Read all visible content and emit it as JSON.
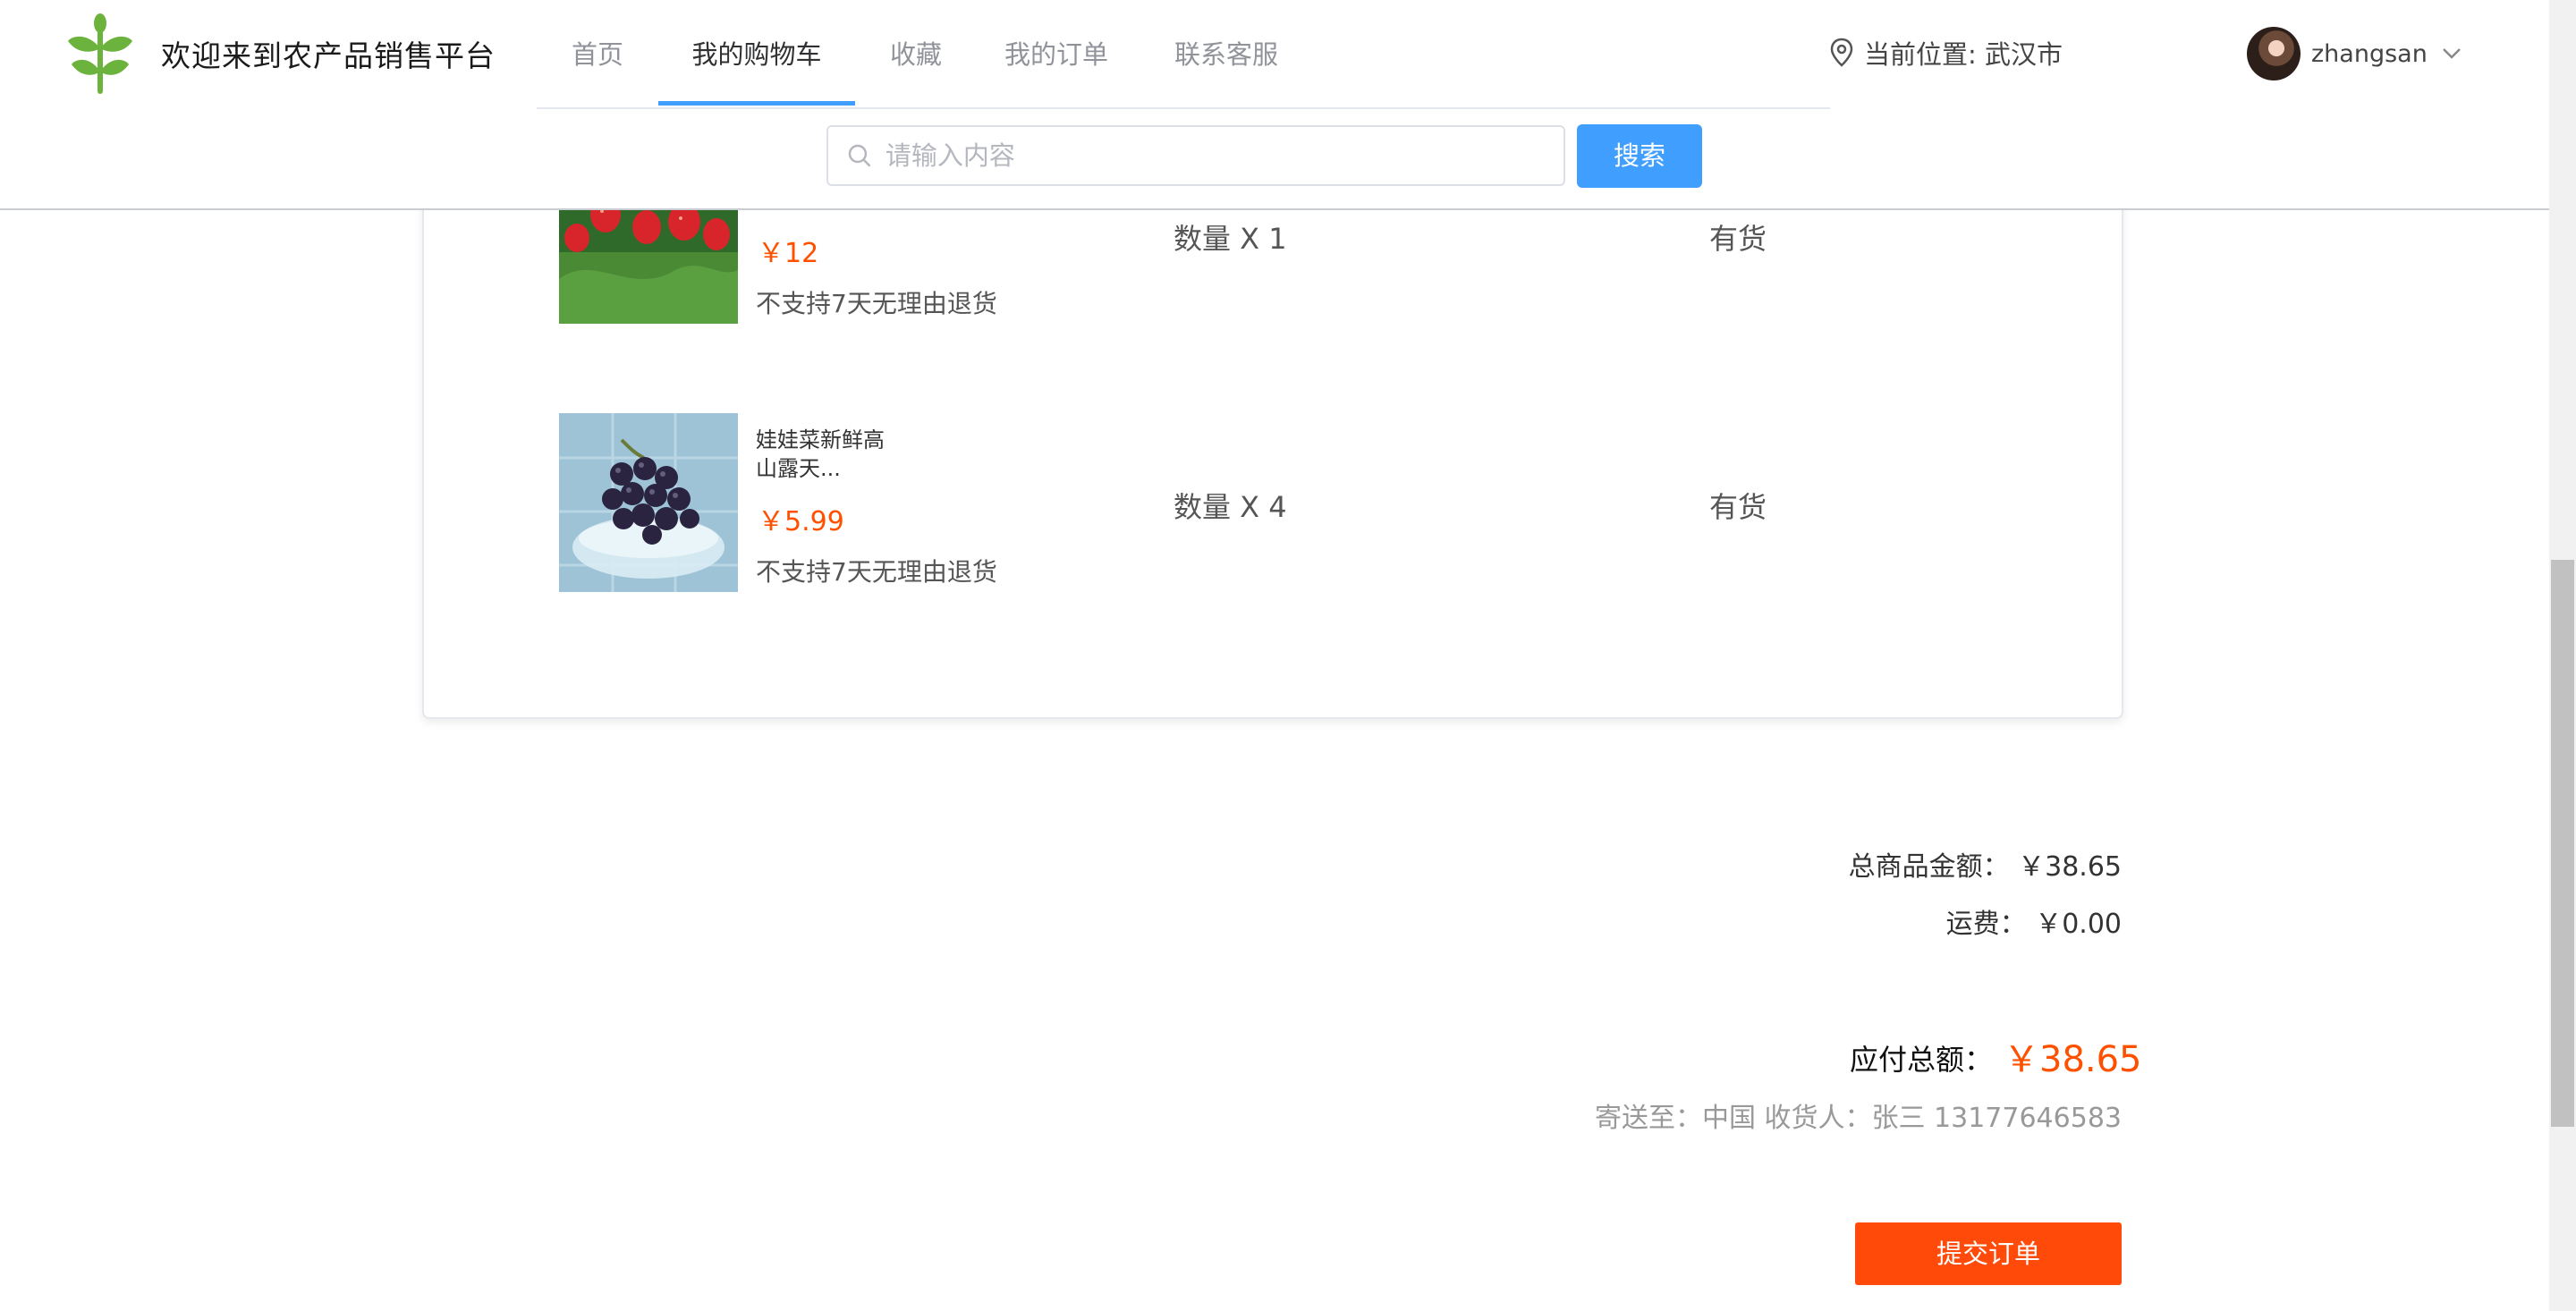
{
  "header": {
    "site_title": "欢迎来到农产品销售平台",
    "logo_icon": "leaf-logo-icon",
    "nav": [
      {
        "label": "首页",
        "active": false
      },
      {
        "label": "我的购物车",
        "active": true
      },
      {
        "label": "收藏",
        "active": false
      },
      {
        "label": "我的订单",
        "active": false
      },
      {
        "label": "联系客服",
        "active": false
      }
    ],
    "location_label": "当前位置: 武汉市",
    "username": "zhangsan"
  },
  "search": {
    "placeholder": "请输入内容",
    "button_label": "搜索"
  },
  "cart_items": [
    {
      "name": "",
      "image": "strawberry",
      "price": "￥12",
      "note": "不支持7天无理由退货",
      "quantity": "数量 X 1",
      "stock": "有货"
    },
    {
      "name": "娃娃菜新鲜高山露天...",
      "image": "grapes",
      "price": "￥5.99",
      "note": "不支持7天无理由退货",
      "quantity": "数量 X 4",
      "stock": "有货"
    }
  ],
  "summary": {
    "goods_total": "总商品金额： ￥38.65",
    "shipping": "运费： ￥0.00",
    "grand_label": "应付总额：",
    "grand_value": "￥38.65",
    "ship_to": "寄送至：中国 收货人：张三 13177646583"
  },
  "submit_label": "提交订单",
  "colors": {
    "accent_blue": "#409eff",
    "price_orange": "#ff5000",
    "submit_bg": "#ff4a0a",
    "logo_green": "#6cb33e"
  }
}
